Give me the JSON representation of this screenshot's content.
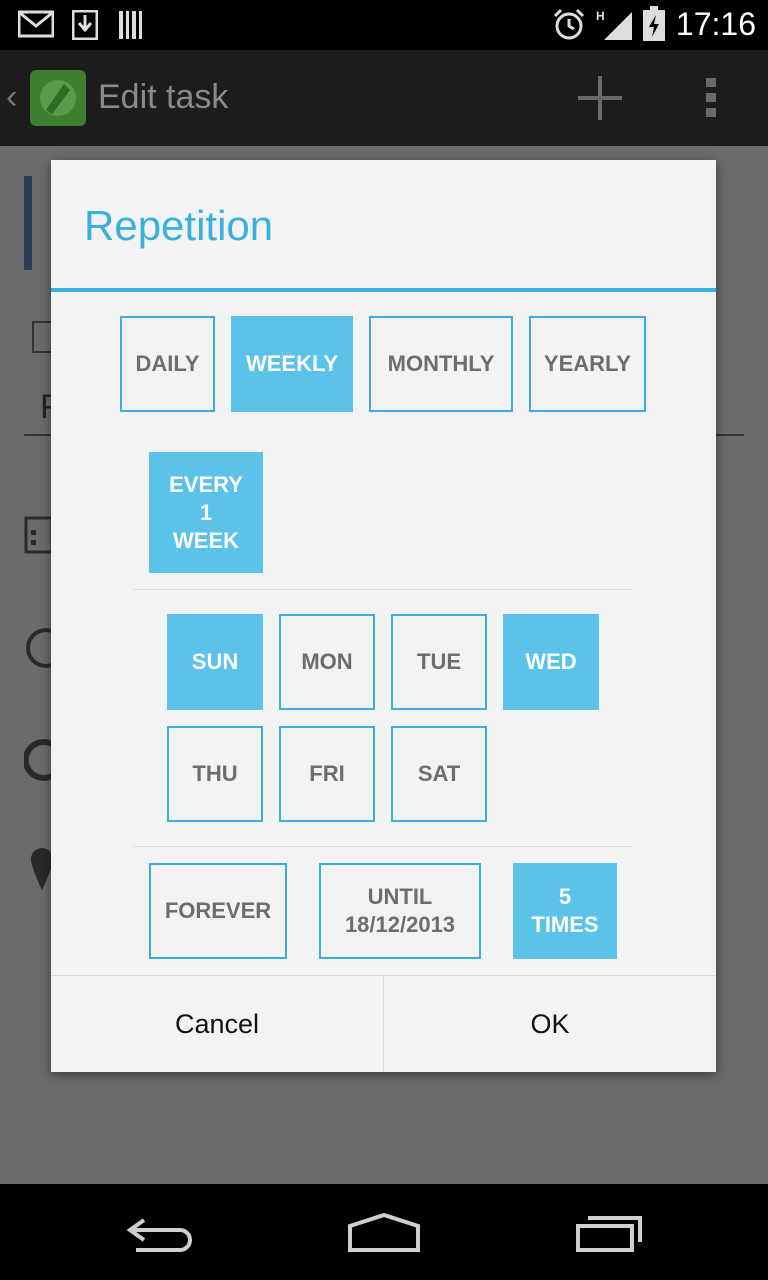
{
  "status_bar": {
    "time": "17:16",
    "icons": [
      "gmail-icon",
      "download-icon",
      "barcode-icon",
      "alarm-icon",
      "signal-h-icon",
      "battery-charging-icon"
    ]
  },
  "action_bar": {
    "title": "Edit task",
    "icons": [
      "back-chevron-icon",
      "app-logo-icon",
      "add-icon",
      "overflow-menu-icon"
    ]
  },
  "background_page": {
    "visible_fragment": "F",
    "icons": [
      "calendar-icon",
      "alarm-icon",
      "repeat-icon",
      "location-pin-icon"
    ]
  },
  "dialog": {
    "title": "Repetition",
    "frequency_options": [
      {
        "label": "DAILY",
        "selected": false
      },
      {
        "label": "WEEKLY",
        "selected": true
      },
      {
        "label": "MONTHLY",
        "selected": false
      },
      {
        "label": "YEARLY",
        "selected": false
      }
    ],
    "interval": {
      "label": "EVERY\n1\nWEEK",
      "selected": true
    },
    "days": [
      {
        "label": "SUN",
        "selected": true
      },
      {
        "label": "MON",
        "selected": false
      },
      {
        "label": "TUE",
        "selected": false
      },
      {
        "label": "WED",
        "selected": true
      },
      {
        "label": "THU",
        "selected": false
      },
      {
        "label": "FRI",
        "selected": false
      },
      {
        "label": "SAT",
        "selected": false
      }
    ],
    "end_options": [
      {
        "label": "FOREVER",
        "selected": false
      },
      {
        "label": "UNTIL\n18/12/2013",
        "selected": false
      },
      {
        "label": "5\nTIMES",
        "selected": true
      }
    ],
    "buttons": {
      "cancel": "Cancel",
      "ok": "OK"
    }
  },
  "colors": {
    "accent": "#39b1dd",
    "selected_fill": "#5bc3ea",
    "unselected_text": "#6d6d6d",
    "dialog_bg": "#f3f3f3"
  }
}
